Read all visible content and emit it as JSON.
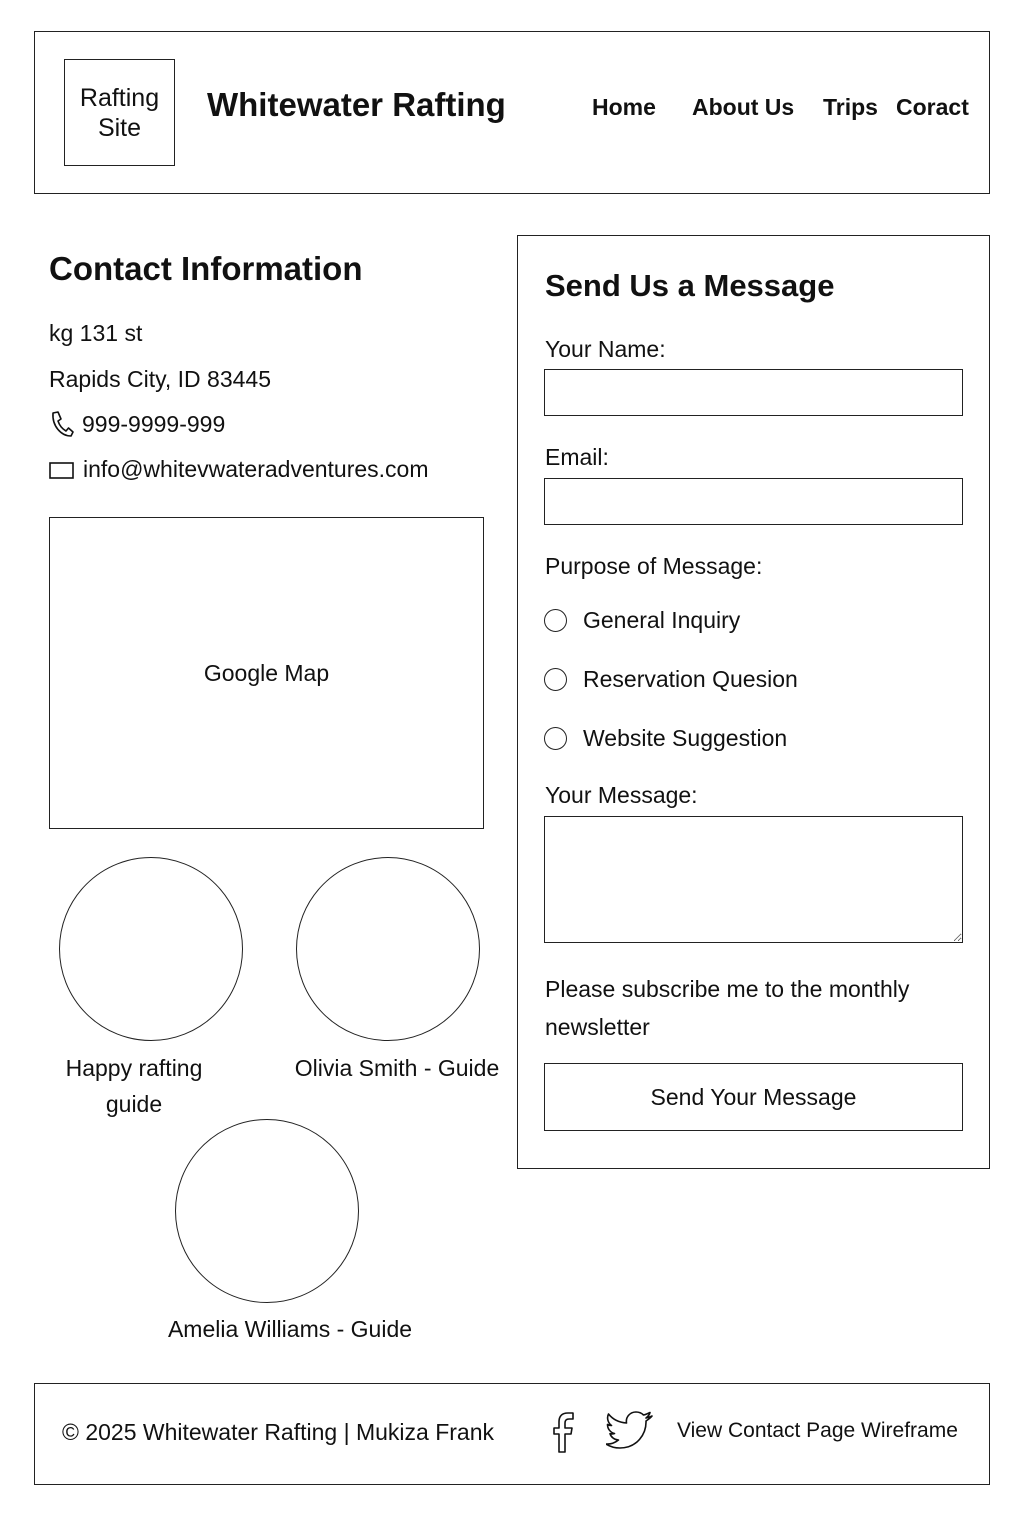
{
  "header": {
    "logo_line1": "Rafting",
    "logo_line2": "Site",
    "site_title": "Whitewater Rafting",
    "nav": [
      "Home",
      "About Us",
      "Trips",
      "Coract"
    ]
  },
  "contact": {
    "heading": "Contact Information",
    "address_line1": "kg 131 st",
    "address_line2": "Rapids City, ID 83445",
    "phone": "999-9999-999",
    "phone_icon": "phone-icon",
    "email": "info@whitevwateradventures.com",
    "email_icon": "envelope-icon",
    "map_label": "Google Map"
  },
  "guides": [
    {
      "name_line1": "Happy rafting",
      "name_line2": "guide"
    },
    {
      "name_line1": "Olivia Smith - Guide"
    },
    {
      "name_line1": "Amelia Williams - Guide"
    }
  ],
  "form": {
    "title": "Send Us a Message",
    "name_label": "Your Name:",
    "name_value": "",
    "email_label": "Email:",
    "email_value": "",
    "purpose_label": "Purpose of Message:",
    "purpose_options": [
      "General Inquiry",
      "Reservation Quesion",
      "Website Suggestion"
    ],
    "message_label": "Your Message:",
    "message_value": "",
    "subscribe_text": "Please subscribe me to the monthly newsletter",
    "submit_label": "Send Your Message"
  },
  "footer": {
    "copyright": "© 2025 Whitewater Rafting | Mukiza Frank",
    "social_icons": [
      "facebook-icon",
      "twitter-icon"
    ],
    "link_label": "View Contact Page Wireframe"
  },
  "colors": {
    "border": "#222222",
    "text": "#111111",
    "background": "#ffffff"
  }
}
